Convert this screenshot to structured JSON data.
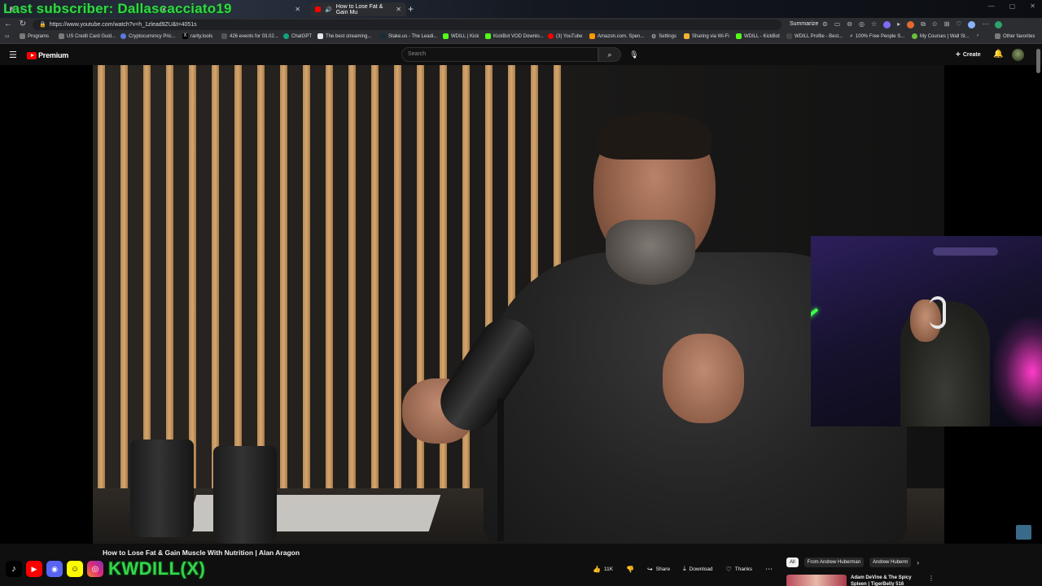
{
  "overlay": {
    "last_subscriber": "Last subscriber: Dallascacciato19"
  },
  "browser": {
    "tabs": [
      {
        "label": "...",
        "active": false
      },
      {
        "label": "...",
        "active": false
      },
      {
        "label": "How to Lose Fat & Gain Mu",
        "active": true
      }
    ],
    "url": "https://www.youtube.com/watch?v=h_1zlead9ZU&t=4051s",
    "summarize_label": "Summarize",
    "favorites": [
      "Programs",
      "US Credit Card Guid...",
      "Cryptocurrency Pric...",
      "rarity.tools",
      "426 events for 03.02...",
      "ChatGPT",
      "The best streaming...",
      "Stake.us - The Leadi...",
      "WDILL | Kick",
      "KickBot VOD Downlo...",
      "(3) YouTube",
      "Amazon.com. Spen...",
      "Settings",
      "Sharing via Wi-Fi",
      "WDILL - KickBot",
      "WDILL Profile - Best...",
      "100% Free People S...",
      "My Courses | Wall St...",
      "Other favorites"
    ]
  },
  "youtube": {
    "logo_text": "Premium",
    "search_placeholder": "Search",
    "create_label": "Create",
    "video_title": "How to Lose Fat & Gain Muscle With Nutrition | Alan Aragon",
    "actions": {
      "likes": "11K",
      "share": "Share",
      "download": "Download",
      "thanks": "Thanks"
    },
    "chips": [
      "All",
      "From Andrew Huberman",
      "Andrew Huberm"
    ],
    "recommended": {
      "title": "Adam DeVine & The Spicy Spleen | TigerBelly 516"
    }
  },
  "stream": {
    "socials": [
      "TikTok",
      "YouTube",
      "Discord",
      "Snapchat",
      "Instagram"
    ],
    "handle": "KWDILL(X)"
  },
  "colors": {
    "overlay_green": "#35d54a",
    "yt_red": "#ff0000",
    "bg": "#0f0f0f"
  }
}
